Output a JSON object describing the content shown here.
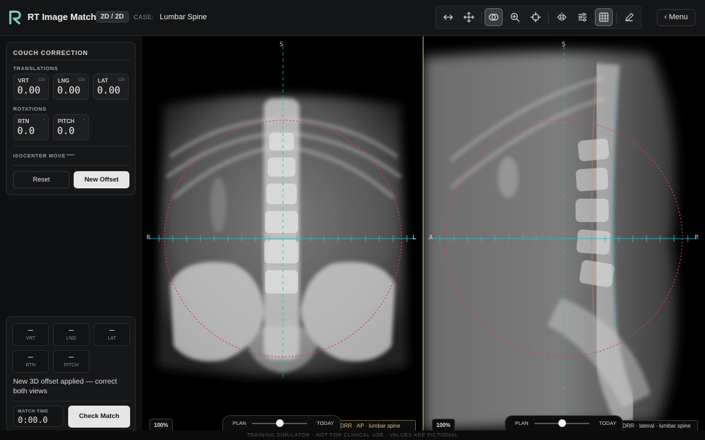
{
  "header": {
    "app_title": "RT Image Match",
    "mode": "2D / 2D",
    "case_label": "CASE:",
    "case_name": "Lumbar Spine",
    "menu_label": "‹ Menu",
    "tools": [
      "arrows-horizontal-icon",
      "move-icon",
      "blend-overlay-icon",
      "zoom-icon",
      "crosshair-icon",
      "mirror-icon",
      "adjust-sliders-icon",
      "grid-icon",
      "pencil-icon"
    ],
    "active_tools": [
      "blend-overlay-icon",
      "grid-icon"
    ]
  },
  "couch_correction": {
    "title": "COUCH CORRECTION",
    "translations_label": "TRANSLATIONS",
    "rotations_label": "ROTATIONS",
    "translations": [
      {
        "label": "VRT",
        "unit": "CM",
        "value": "0.00"
      },
      {
        "label": "LNG",
        "unit": "CM",
        "value": "0.00"
      },
      {
        "label": "LAT",
        "unit": "CM",
        "value": "0.00"
      }
    ],
    "rotations": [
      {
        "label": "RTN",
        "unit": "°",
        "value": "0.0"
      },
      {
        "label": "PITCH",
        "unit": "°",
        "value": "0.0"
      }
    ],
    "isocenter_label": "ISOCENTER MOVE",
    "isocenter_value": "—",
    "reset_label": "Reset",
    "new_offset_label": "New Offset"
  },
  "offset_panel": {
    "readouts": [
      {
        "label": "VRT",
        "value": "–"
      },
      {
        "label": "LNG",
        "value": "–"
      },
      {
        "label": "LAT",
        "value": "–"
      },
      {
        "label": "RTN",
        "value": "–"
      },
      {
        "label": "PITCH",
        "value": "–"
      }
    ],
    "message": "New 3D offset applied — correct both views",
    "match_time_label": "MATCH TIME",
    "match_time_value": "0:00.0",
    "check_label": "Check Match"
  },
  "views": {
    "ap": {
      "top": "S",
      "left": "R",
      "right": "L",
      "zoom": "100%",
      "caption": "DRR · AP · lumbar spine",
      "blend_left": "PLAN",
      "blend_right": "TODAY",
      "blend": 0.5
    },
    "lateral": {
      "top": "S",
      "left": "A",
      "right": "P",
      "zoom": "100%",
      "caption": "DRR · lateral · lumbar spine",
      "blend_left": "PLAN",
      "blend_right": "TODAY",
      "blend": 0.5
    }
  },
  "footer": "TRAINING SIMULATOR · NOT FOR CLINICAL USE · VALUES ARE FICTIONAL",
  "colors": {
    "accent_overlay": "#2fb6c8",
    "iso_circle": "#d2434b",
    "divider": "#cdbb86"
  }
}
